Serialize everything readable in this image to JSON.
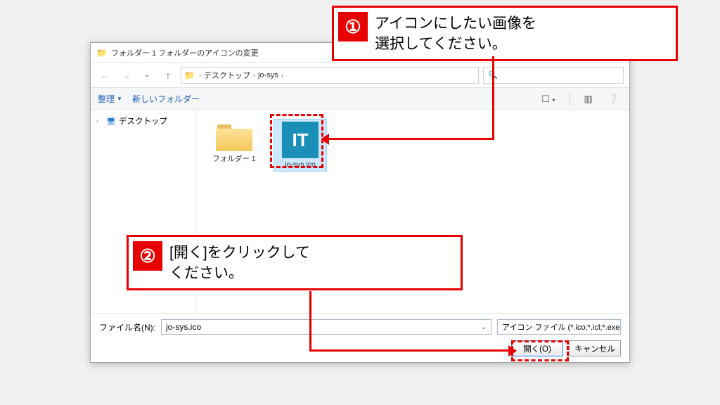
{
  "dialog": {
    "title": "フォルダー 1  フォルダーのアイコンの変更"
  },
  "breadcrumb": {
    "seg1": "デスクトップ",
    "seg2": "jo-sys"
  },
  "search": {
    "placeholder": ""
  },
  "toolbar": {
    "organize": "整理",
    "newfolder": "新しいフォルダー"
  },
  "sidebar": {
    "desktop": "デスクトップ"
  },
  "files": {
    "folder1": "フォルダー 1",
    "icofile": "jo-sys.ico",
    "itlogo": "IT"
  },
  "bottom": {
    "filename_label": "ファイル名(N):",
    "filename_value": "jo-sys.ico",
    "filter": "アイコン ファイル (*.ico;*.icl;*.exe;*",
    "open": "開く(O)",
    "cancel": "キャンセル"
  },
  "callouts": {
    "c1_num": "①",
    "c1_text": "アイコンにしたい画像を\n選択してください。",
    "c2_num": "②",
    "c2_text": "[開く]をクリックして\nください。"
  }
}
